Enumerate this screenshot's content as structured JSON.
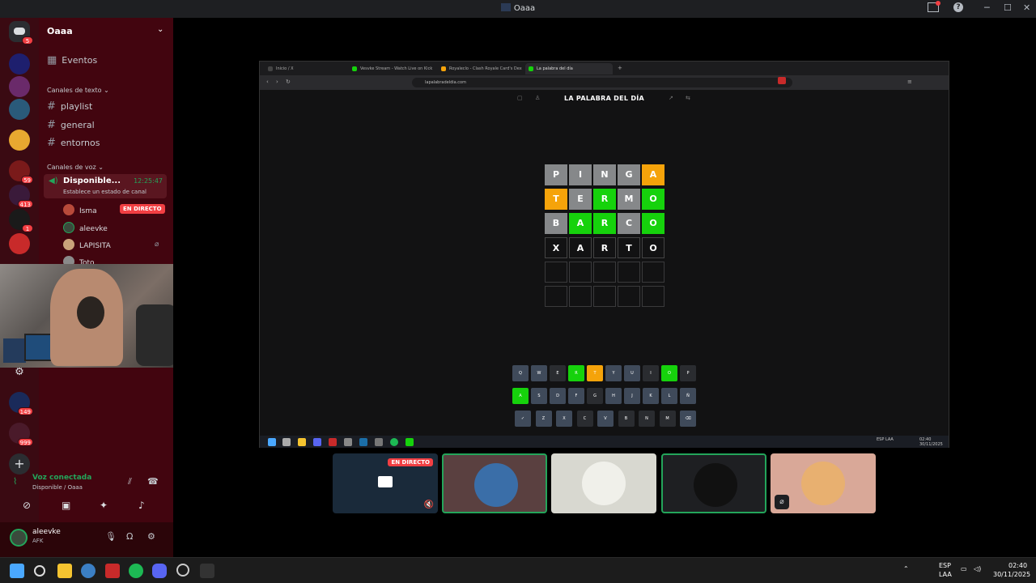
{
  "window": {
    "title": "Oaaa",
    "help": "?",
    "minimize": "─",
    "maximize": "☐",
    "close": "✕"
  },
  "server": {
    "name": "Oaaa",
    "events": "Eventos",
    "text_category": "Canales de texto",
    "text_channels": [
      "playlist",
      "general",
      "entornos"
    ],
    "voice_category": "Canales de voz",
    "voice_channel": {
      "name": "Disponible...",
      "time": "12:25:47",
      "status": "Establece un estado de canal"
    },
    "voice_users": [
      {
        "name": "Isma",
        "badge": "EN DIRECTO",
        "color": "#b84a3a"
      },
      {
        "name": "aleevke",
        "color": "#3a4a3c"
      },
      {
        "name": "LAPISITA",
        "color": "#c9a27a"
      },
      {
        "name": "Toto",
        "color": "#8a8a8a"
      }
    ]
  },
  "server_badges": [
    "5",
    "59",
    "413",
    "1",
    "149",
    "999"
  ],
  "voice_connection": {
    "label": "Voz conectada",
    "sub": "Disponible / Oaaa"
  },
  "user": {
    "name": "aleevke",
    "status": "AFK"
  },
  "browser": {
    "tabs": [
      {
        "label": "Inicio / X",
        "color": "#444"
      },
      {
        "label": "Vesvke Stream - Watch Live on Kick",
        "color": "#16d20c"
      },
      {
        "label": "Royaleclo - Clash Royale Card's Dex",
        "color": "#f5a30a"
      },
      {
        "label": "La palabra del día",
        "color": "#16d20c"
      }
    ],
    "url": "lapalabradeldia.com",
    "game_title": "LA PALABRA DEL DÍA"
  },
  "board": [
    [
      [
        "P",
        "grey"
      ],
      [
        "I",
        "grey"
      ],
      [
        "N",
        "grey"
      ],
      [
        "G",
        "grey"
      ],
      [
        "A",
        "yel"
      ]
    ],
    [
      [
        "T",
        "yel"
      ],
      [
        "E",
        "grey"
      ],
      [
        "R",
        "grn"
      ],
      [
        "M",
        "grey"
      ],
      [
        "O",
        "grn"
      ]
    ],
    [
      [
        "B",
        "grey"
      ],
      [
        "A",
        "grn"
      ],
      [
        "R",
        "grn"
      ],
      [
        "C",
        "grey"
      ],
      [
        "O",
        "grn"
      ]
    ],
    [
      [
        "X",
        "cur"
      ],
      [
        "A",
        "cur"
      ],
      [
        "R",
        "cur"
      ],
      [
        "T",
        "cur"
      ],
      [
        "O",
        "cur"
      ]
    ],
    [
      [
        "",
        "emp"
      ],
      [
        "",
        "emp"
      ],
      [
        "",
        "emp"
      ],
      [
        "",
        "emp"
      ],
      [
        "",
        "emp"
      ]
    ],
    [
      [
        "",
        "emp"
      ],
      [
        "",
        "emp"
      ],
      [
        "",
        "emp"
      ],
      [
        "",
        "emp"
      ],
      [
        "",
        "emp"
      ]
    ]
  ],
  "keyboard": [
    [
      [
        "Q",
        ""
      ],
      [
        "W",
        ""
      ],
      [
        "E",
        "grey"
      ],
      [
        "R",
        "grn"
      ],
      [
        "T",
        "yel"
      ],
      [
        "Y",
        ""
      ],
      [
        "U",
        ""
      ],
      [
        "I",
        "grey"
      ],
      [
        "O",
        "grn"
      ],
      [
        "P",
        "grey"
      ]
    ],
    [
      [
        "A",
        "grn"
      ],
      [
        "S",
        ""
      ],
      [
        "D",
        ""
      ],
      [
        "F",
        ""
      ],
      [
        "G",
        "grey"
      ],
      [
        "H",
        ""
      ],
      [
        "J",
        ""
      ],
      [
        "K",
        ""
      ],
      [
        "L",
        ""
      ],
      [
        "Ñ",
        ""
      ]
    ],
    [
      [
        "✓",
        ""
      ],
      [
        "Z",
        ""
      ],
      [
        "X",
        ""
      ],
      [
        "C",
        "grey"
      ],
      [
        "V",
        ""
      ],
      [
        "B",
        "grey"
      ],
      [
        "N",
        "grey"
      ],
      [
        "M",
        "grey"
      ],
      [
        "⌫",
        ""
      ]
    ]
  ],
  "stream_tiles": [
    {
      "name": "stream-tile-isma",
      "live": "EN DIRECTO",
      "bg": "#1a2a3a",
      "highlight": false
    },
    {
      "name": "tile-aleevke",
      "bg": "#5a4040",
      "circle": "#3a6ea8",
      "highlight": true
    },
    {
      "name": "tile-pingu",
      "bg": "#d8d8d0",
      "circle": "#f0f0ea",
      "highlight": false
    },
    {
      "name": "tile-dark",
      "bg": "#1e1f22",
      "circle": "#111",
      "highlight": true
    },
    {
      "name": "tile-cat",
      "bg": "#d9a898",
      "circle": "#e8b070",
      "highlight": false
    }
  ],
  "inner_taskbar": {
    "lang": "ESP\nLAA",
    "time": "02:40",
    "date": "30/11/2025"
  },
  "taskbar": {
    "lang": "ESP",
    "region": "LAA",
    "time": "02:40",
    "date": "30/11/2025"
  }
}
